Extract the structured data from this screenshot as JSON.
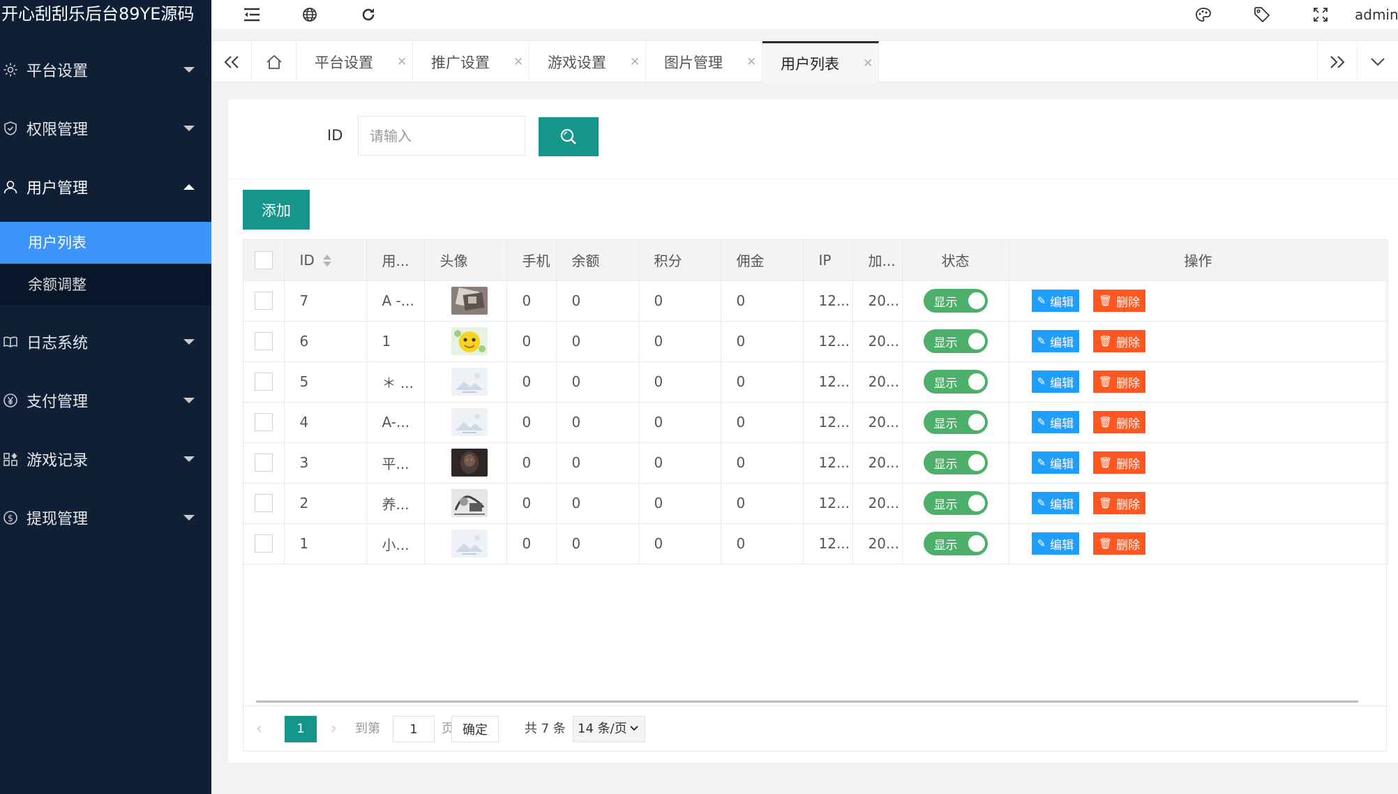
{
  "app": {
    "title": "开心刮刮乐后台89YE源码"
  },
  "sidebar": {
    "groups": [
      {
        "label": "平台设置",
        "icon": "gear-icon"
      },
      {
        "label": "权限管理",
        "icon": "shield-icon"
      },
      {
        "label": "用户管理",
        "icon": "user-icon"
      },
      {
        "label": "日志系统",
        "icon": "book-icon"
      },
      {
        "label": "支付管理",
        "icon": "yen-icon"
      },
      {
        "label": "游戏记录",
        "icon": "apps-icon"
      },
      {
        "label": "提现管理",
        "icon": "dollar-icon"
      }
    ],
    "sub_items": [
      {
        "label": "用户列表",
        "active": true
      },
      {
        "label": "余额调整",
        "active": false
      }
    ]
  },
  "header": {
    "icons": [
      "menu-fold-icon",
      "globe-icon",
      "refresh-icon",
      "theme-icon",
      "tag-icon",
      "fullscreen-icon"
    ],
    "user": "admin"
  },
  "tabs": [
    {
      "label": "平台设置",
      "active": false
    },
    {
      "label": "推广设置",
      "active": false
    },
    {
      "label": "游戏设置",
      "active": false
    },
    {
      "label": "图片管理",
      "active": false
    },
    {
      "label": "用户列表",
      "active": true
    }
  ],
  "search": {
    "label": "ID",
    "placeholder": "请输入"
  },
  "toolbar": {
    "add_label": "添加"
  },
  "table": {
    "columns": [
      "ID",
      "用...",
      "头像",
      "手机",
      "余额",
      "积分",
      "佣金",
      "IP",
      "加...",
      "状态",
      "操作"
    ],
    "rows": [
      {
        "id": "7",
        "user": "A -...",
        "avatar": "photo-cards",
        "phone": "0",
        "balance": "0",
        "points": "0",
        "commission": "0",
        "ip": "12...",
        "added": "20...",
        "status": "显示"
      },
      {
        "id": "6",
        "user": "1",
        "avatar": "photo-cartoon",
        "phone": "0",
        "balance": "0",
        "points": "0",
        "commission": "0",
        "ip": "12...",
        "added": "20...",
        "status": "显示"
      },
      {
        "id": "5",
        "user": "＊ ...",
        "avatar": "placeholder",
        "phone": "0",
        "balance": "0",
        "points": "0",
        "commission": "0",
        "ip": "12...",
        "added": "20...",
        "status": "显示"
      },
      {
        "id": "4",
        "user": "A-...",
        "avatar": "placeholder",
        "phone": "0",
        "balance": "0",
        "points": "0",
        "commission": "0",
        "ip": "12...",
        "added": "20...",
        "status": "显示"
      },
      {
        "id": "3",
        "user": "平...",
        "avatar": "photo-dark",
        "phone": "0",
        "balance": "0",
        "points": "0",
        "commission": "0",
        "ip": "12...",
        "added": "20...",
        "status": "显示"
      },
      {
        "id": "2",
        "user": "养...",
        "avatar": "photo-sketch",
        "phone": "0",
        "balance": "0",
        "points": "0",
        "commission": "0",
        "ip": "12...",
        "added": "20...",
        "status": "显示"
      },
      {
        "id": "1",
        "user": "小...",
        "avatar": "placeholder",
        "phone": "0",
        "balance": "0",
        "points": "0",
        "commission": "0",
        "ip": "12...",
        "added": "20...",
        "status": "显示"
      }
    ],
    "actions": {
      "edit": "编辑",
      "delete": "删除"
    }
  },
  "pagination": {
    "current": "1",
    "goto_label": "到第",
    "page_value": "1",
    "page_unit": "页",
    "confirm": "确定",
    "total": "共 7 条",
    "page_size": "14 条/页"
  },
  "colors": {
    "sidebar_bg": "#0e1f36",
    "active_blue": "#3d95fb",
    "primary_teal": "#16968a",
    "toggle_green": "#4caf6a",
    "edit_blue": "#1e9fff",
    "delete_orange": "#ff5722"
  }
}
